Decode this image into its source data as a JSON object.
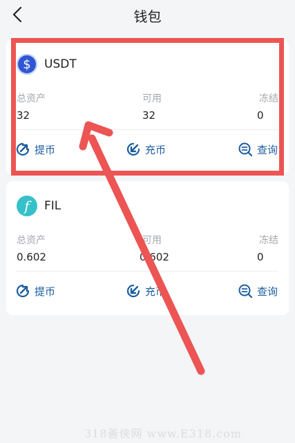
{
  "header": {
    "title": "钱包"
  },
  "wallets": [
    {
      "name": "USDT",
      "icon": "usdt-dollar-icon",
      "color": "#2f56d3",
      "total_label": "总资产",
      "total_value": "32",
      "available_label": "可用",
      "available_value": "32",
      "frozen_label": "冻结",
      "frozen_value": "0",
      "withdraw_label": "提币",
      "deposit_label": "充币",
      "query_label": "查询"
    },
    {
      "name": "FIL",
      "icon": "fil-icon",
      "color": "#36c0c8",
      "total_label": "总资产",
      "total_value": "0.602",
      "available_label": "可用",
      "available_value": "0.602",
      "frozen_label": "冻结",
      "frozen_value": "0",
      "withdraw_label": "提币",
      "deposit_label": "充币",
      "query_label": "查询"
    }
  ],
  "annotation": {
    "highlight_color": "#ec5553"
  },
  "watermark": "318善侠网 www.E318.com"
}
